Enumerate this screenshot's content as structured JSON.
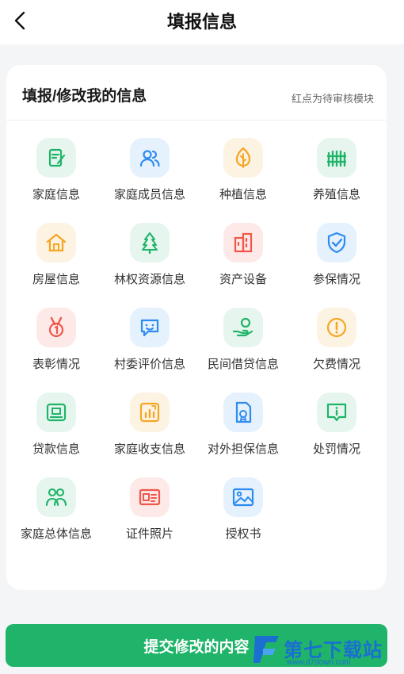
{
  "header": {
    "title": "填报信息"
  },
  "card": {
    "title": "填报/修改我的信息",
    "note": "红点为待审核模块"
  },
  "modules": [
    {
      "label": "家庭信息",
      "icon": "edit-form-icon",
      "color": "#1fb469",
      "bg": "#e6f6ee"
    },
    {
      "label": "家庭成员信息",
      "icon": "users-icon",
      "color": "#2d8cf0",
      "bg": "#e5f1fd"
    },
    {
      "label": "种植信息",
      "icon": "leaf-icon",
      "color": "#f5a623",
      "bg": "#fdf3e3"
    },
    {
      "label": "养殖信息",
      "icon": "fence-icon",
      "color": "#1fb469",
      "bg": "#e6f6ee"
    },
    {
      "label": "房屋信息",
      "icon": "house-icon",
      "color": "#f5a623",
      "bg": "#fdf3e3"
    },
    {
      "label": "林权资源信息",
      "icon": "tree-icon",
      "color": "#1fb469",
      "bg": "#e6f6ee"
    },
    {
      "label": "资产设备",
      "icon": "building-icon",
      "color": "#f0574a",
      "bg": "#fde9e7"
    },
    {
      "label": "参保情况",
      "icon": "shield-check-icon",
      "color": "#2d8cf0",
      "bg": "#e5f1fd"
    },
    {
      "label": "表彰情况",
      "icon": "medal-icon",
      "color": "#f0574a",
      "bg": "#fde9e7"
    },
    {
      "label": "村委评价信息",
      "icon": "chat-smile-icon",
      "color": "#2d8cf0",
      "bg": "#e5f1fd"
    },
    {
      "label": "民间借贷信息",
      "icon": "hand-coin-icon",
      "color": "#1fb469",
      "bg": "#e6f6ee"
    },
    {
      "label": "欠费情况",
      "icon": "alert-circle-icon",
      "color": "#f5a623",
      "bg": "#fdf3e3"
    },
    {
      "label": "贷款信息",
      "icon": "wallet-icon",
      "color": "#1fb469",
      "bg": "#e6f6ee"
    },
    {
      "label": "家庭收支信息",
      "icon": "bar-chart-icon",
      "color": "#f5a623",
      "bg": "#fdf3e3"
    },
    {
      "label": "对外担保信息",
      "icon": "guarantee-doc-icon",
      "color": "#2d8cf0",
      "bg": "#e5f1fd"
    },
    {
      "label": "处罚情况",
      "icon": "info-message-icon",
      "color": "#1fb469",
      "bg": "#e6f6ee"
    },
    {
      "label": "家庭总体信息",
      "icon": "group-icon",
      "color": "#1fb469",
      "bg": "#e6f6ee"
    },
    {
      "label": "证件照片",
      "icon": "id-card-icon",
      "color": "#f0574a",
      "bg": "#fde9e7"
    },
    {
      "label": "授权书",
      "icon": "image-icon",
      "color": "#2d8cf0",
      "bg": "#e5f1fd"
    }
  ],
  "footer": {
    "submit_label": "提交修改的内容"
  },
  "watermark": {
    "text": "第七下载站",
    "url": "www.d7down.com",
    "color": "#1a6fd1"
  }
}
